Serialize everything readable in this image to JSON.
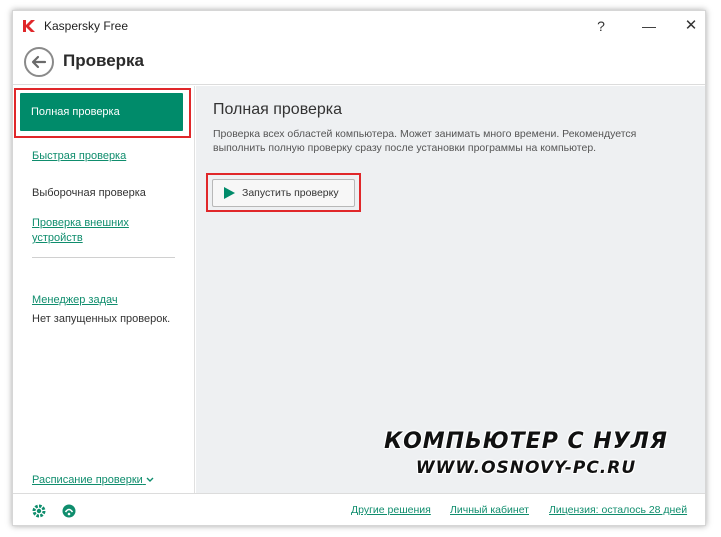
{
  "window": {
    "app_title": "Kaspersky Free",
    "help_label": "?",
    "minimize_label": "—",
    "close_label": "✕"
  },
  "header": {
    "page_title": "Проверка"
  },
  "sidebar": {
    "items": [
      {
        "label": "Полная проверка",
        "active": true
      },
      {
        "label": "Быстрая проверка",
        "active": false
      },
      {
        "label": "Выборочная проверка",
        "active": false
      },
      {
        "label": "Проверка внешних устройств",
        "active": false
      }
    ],
    "task_manager_label": "Менеджер задач",
    "no_scans_text": "Нет запущенных проверок.",
    "schedule_label": "Расписание проверки"
  },
  "main": {
    "title": "Полная проверка",
    "description": "Проверка всех областей компьютера. Может занимать много времени. Рекомендуется выполнить полную проверку сразу после установки программы на компьютер.",
    "run_button_label": "Запустить проверку"
  },
  "footer": {
    "links": [
      "Другие решения",
      "Личный кабинет",
      "Лицензия: осталось 28 дней"
    ]
  },
  "watermark": {
    "line1": "КОМПЬЮТЕР С НУЛЯ",
    "line2": "WWW.OSNOVY-PC.RU"
  },
  "colors": {
    "accent": "#008b6a",
    "highlight": "#e0272a",
    "link": "#0f8d6d"
  },
  "icons": {
    "logo": "kaspersky-logo",
    "back": "arrow-left-icon",
    "run": "play-icon",
    "settings": "gear-icon",
    "support": "support-icon"
  }
}
